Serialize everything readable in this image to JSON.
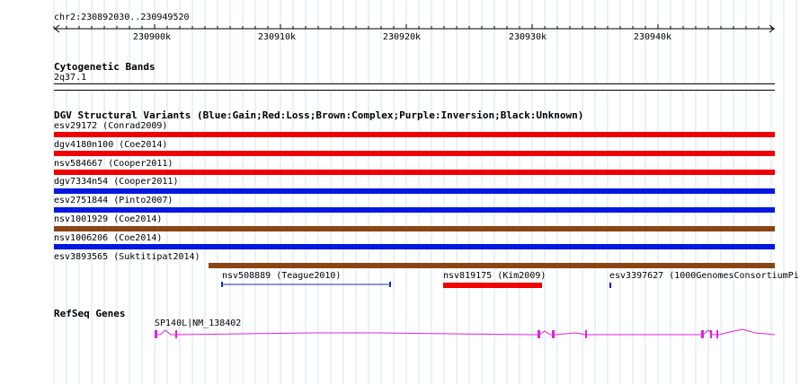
{
  "ruler": {
    "location": "chr2:230892030..230949520",
    "ticks": [
      "230900k",
      "230910k",
      "230920k",
      "230930k",
      "230940k"
    ]
  },
  "cytoband": {
    "title": "Cytogenetic Bands",
    "band": "2q37.1"
  },
  "dgv": {
    "title": "DGV Structural Variants (Blue:Gain;Red:Loss;Brown:Complex;Purple:Inversion;Black:Unknown)",
    "colors": {
      "gain": "#0018e0",
      "loss": "#f00000",
      "complex": "#8b4513",
      "span": "#1a30b0"
    },
    "variants": [
      {
        "label": "esv29172 (Conrad2009)",
        "type": "loss"
      },
      {
        "label": "dgv4180n100 (Coe2014)",
        "type": "loss"
      },
      {
        "label": "nsv584667 (Cooper2011)",
        "type": "loss"
      },
      {
        "label": "dgv7334n54 (Cooper2011)",
        "type": "gain"
      },
      {
        "label": "esv2751844 (Pinto2007)",
        "type": "gain"
      },
      {
        "label": "nsv1001929 (Coe2014)",
        "type": "complex"
      },
      {
        "label": "nsv1006206 (Coe2014)",
        "type": "gain"
      },
      {
        "label": "esv3893565 (Suktitipat2014)",
        "type": "complex"
      },
      {
        "label": "nsv508889 (Teague2010)",
        "type": "span"
      },
      {
        "label": "nsv819175 (Kim2009)",
        "type": "loss"
      },
      {
        "label": "esv3397627 (1000GenomesConsortiumPi",
        "type": "gain"
      }
    ]
  },
  "refseq": {
    "title": "RefSeq Genes",
    "gene_label": "SP140L|NM_138402",
    "color": "#e020e0"
  }
}
